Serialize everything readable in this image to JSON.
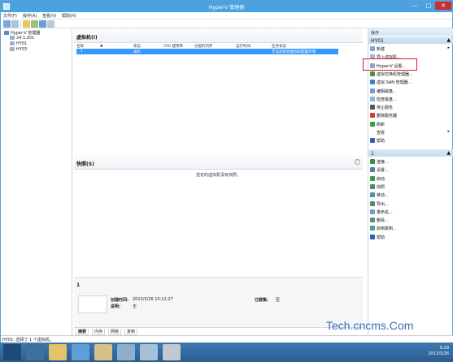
{
  "window": {
    "title": "Hyper-V 管理器",
    "minimize": "—",
    "maximize": "□",
    "close": "✕"
  },
  "menu": [
    {
      "label": "文件(F)"
    },
    {
      "label": "操作(A)"
    },
    {
      "label": "查看(V)"
    },
    {
      "label": "帮助(H)"
    }
  ],
  "tree": {
    "root": "Hyper-V 管理器",
    "nodes": [
      "24.1.201",
      "HY01",
      "HY03"
    ]
  },
  "vm_panel": {
    "title": "虚拟机(I)",
    "columns": [
      "名称",
      "状态",
      "CPU 使用率",
      "分配的内存",
      "运行时间",
      "任务状态"
    ],
    "rows": [
      {
        "name": "1",
        "state": "关机",
        "cpu": "",
        "memory": "",
        "uptime": "",
        "status": "无法连接到虚拟机配置存储"
      }
    ]
  },
  "snapshot_panel": {
    "title": "快照(S)",
    "empty_text": "选定的虚拟机没有快照。"
  },
  "detail_panel": {
    "title": "1",
    "created_label": "创建时间:",
    "created_value": "2013/3/26 15:12:27",
    "notes_label": "说明:",
    "notes_value": "无",
    "clustered_label": "已群集:",
    "clustered_value": "否",
    "tabs": [
      "摘要",
      "内存",
      "网络",
      "复制"
    ]
  },
  "actions": {
    "header": "操作",
    "host_section": "HY01",
    "host_items": [
      {
        "label": "新建",
        "icon": "new-icon",
        "submenu": true
      },
      {
        "label": "导入虚拟机...",
        "icon": "import-icon"
      },
      {
        "label": "Hyper-V 设置...",
        "icon": "settings-icon"
      },
      {
        "label": "虚拟交换机管理器...",
        "icon": "switch-icon"
      },
      {
        "label": "虚拟 SAN 管理器...",
        "icon": "san-icon"
      },
      {
        "label": "编辑磁盘...",
        "icon": "edit-disk-icon"
      },
      {
        "label": "检查磁盘...",
        "icon": "inspect-disk-icon"
      },
      {
        "label": "停止服务",
        "icon": "stop-icon"
      },
      {
        "label": "删除服务器",
        "icon": "delete-icon"
      },
      {
        "label": "刷新",
        "icon": "refresh-icon"
      },
      {
        "label": "查看",
        "icon": "view-icon",
        "submenu": true
      },
      {
        "label": "帮助",
        "icon": "help-icon"
      }
    ],
    "vm_section": "1",
    "vm_items": [
      {
        "label": "连接...",
        "icon": "connect-icon"
      },
      {
        "label": "设置...",
        "icon": "vm-settings-icon"
      },
      {
        "label": "启动",
        "icon": "start-icon"
      },
      {
        "label": "快照",
        "icon": "snapshot-icon"
      },
      {
        "label": "移动...",
        "icon": "move-icon"
      },
      {
        "label": "导出...",
        "icon": "export-icon"
      },
      {
        "label": "重命名...",
        "icon": "rename-icon"
      },
      {
        "label": "删除...",
        "icon": "vm-delete-icon"
      },
      {
        "label": "启用复制...",
        "icon": "replication-icon"
      },
      {
        "label": "帮助",
        "icon": "vm-help-icon"
      }
    ]
  },
  "status_bar": "HY01: 选择了 1 个虚拟机。",
  "watermark": "Tech.cncms.Com",
  "clock": {
    "time": "9:29",
    "date": "2013/3/26"
  },
  "colors": {
    "accent": "#4aa3e0",
    "selection": "#3399ff",
    "highlight_box": "#d02020",
    "taskbar": "#2c5d8f"
  }
}
